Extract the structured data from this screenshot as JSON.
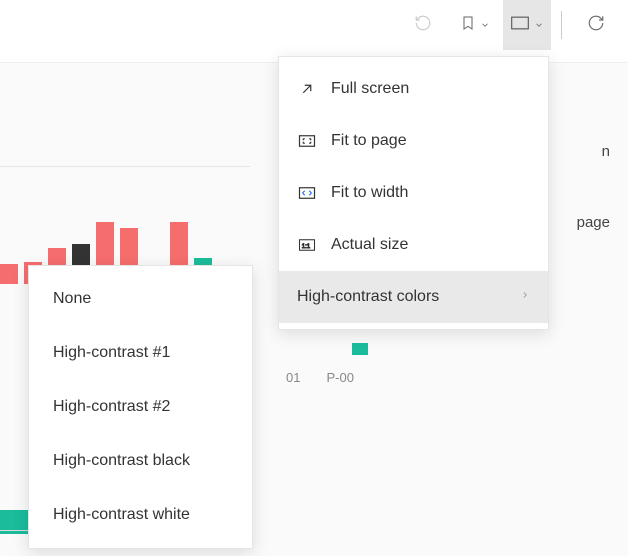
{
  "toolbar": {
    "reset": "Reset",
    "bookmark": "Bookmarks",
    "view": "View",
    "refresh": "Refresh"
  },
  "view_menu": {
    "full_screen": "Full screen",
    "fit_to_page": "Fit to page",
    "fit_to_width": "Fit to width",
    "actual_size": "Actual size",
    "high_contrast": "High-contrast colors"
  },
  "hc_menu": {
    "none": "None",
    "hc1": "High-contrast #1",
    "hc2": "High-contrast #2",
    "hc_black": "High-contrast black",
    "hc_white": "High-contrast white"
  },
  "chart_data": {
    "type": "bar",
    "series": [
      {
        "name": "red",
        "color": "#f66d6d",
        "values": [
          20,
          22,
          36,
          0,
          62,
          56,
          0
        ]
      },
      {
        "name": "dark",
        "color": "#333333",
        "values": [
          0,
          0,
          0,
          40,
          0,
          0,
          0
        ]
      },
      {
        "name": "teal",
        "color": "#1abc9c",
        "values": [
          0,
          0,
          0,
          0,
          0,
          0,
          26
        ]
      }
    ],
    "categories": [
      "01",
      "P-00"
    ]
  },
  "background": {
    "axis1": "01",
    "axis2": "P-00",
    "page": "page",
    "n": "n"
  }
}
